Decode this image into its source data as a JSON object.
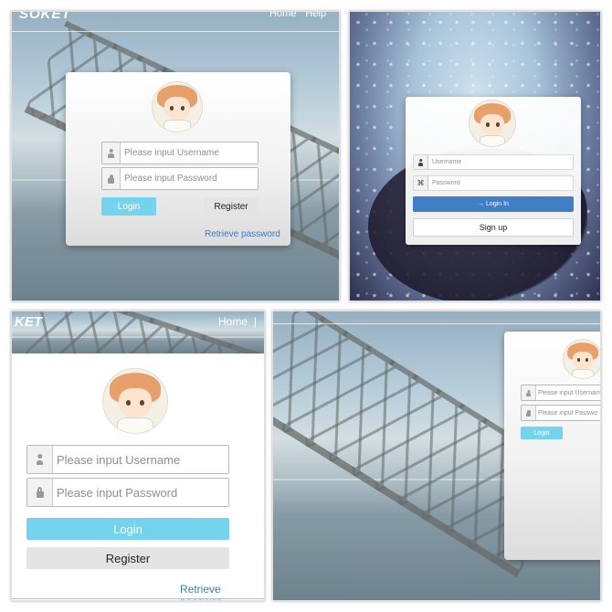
{
  "brand": "SOKET",
  "brand_partial": "KET",
  "nav": {
    "home": "Home",
    "help": "Help",
    "separator": "|"
  },
  "login_form": {
    "username_placeholder": "Please input Username",
    "password_placeholder": "Please input Password",
    "login_label": "Login",
    "register_label": "Register",
    "retrieve_label": "Retrieve password",
    "retrieve_label_cut": "Retrieve passwor"
  },
  "rain_form": {
    "username_placeholder": "Username",
    "password_placeholder": "Password",
    "login_label": "Login In",
    "signup_label": "Sign up"
  },
  "cropped_form": {
    "username_placeholder": "Please input Usernam",
    "password_placeholder": "Please input Passwo",
    "login_label": "Login"
  },
  "colors": {
    "login_cyan": "#74d4ee",
    "login_blue": "#3f7fc6",
    "link_blue": "#3d7ab8"
  },
  "icons": [
    "person-icon",
    "lock-icon",
    "key-icon",
    "sign-in-icon"
  ]
}
